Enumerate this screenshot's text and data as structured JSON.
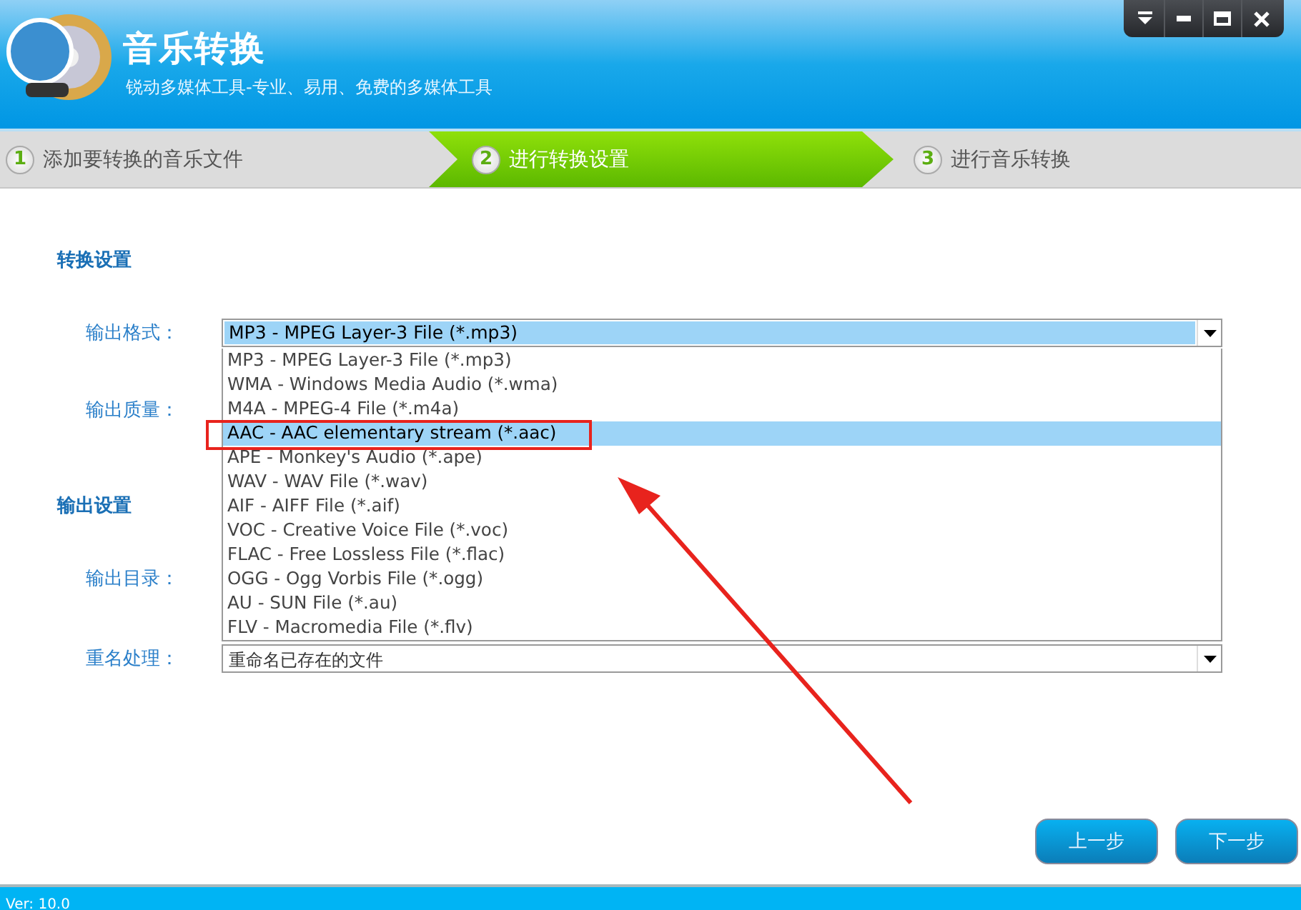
{
  "window": {
    "title": "音乐转换",
    "subtitle": "锐动多媒体工具-专业、易用、免费的多媒体工具"
  },
  "steps": [
    {
      "number": "1",
      "label": "添加要转换的音乐文件",
      "selected": false
    },
    {
      "number": "2",
      "label": "进行转换设置",
      "selected": true
    },
    {
      "number": "3",
      "label": "进行音乐转换",
      "selected": false
    }
  ],
  "conversion_settings": {
    "heading": "转换设置",
    "format": {
      "label": "输出格式：",
      "value": "MP3 - MPEG Layer-3 File (*.mp3)",
      "expanded": true,
      "options": [
        {
          "label": "MP3 - MPEG Layer-3 File (*.mp3)",
          "highlighted": false,
          "boxed": false
        },
        {
          "label": "WMA - Windows Media Audio (*.wma)",
          "highlighted": false,
          "boxed": false
        },
        {
          "label": "M4A - MPEG-4 File (*.m4a)",
          "highlighted": false,
          "boxed": false
        },
        {
          "label": "AAC - AAC elementary stream (*.aac)",
          "highlighted": true,
          "boxed": true
        },
        {
          "label": "APE - Monkey's Audio (*.ape)",
          "highlighted": false,
          "boxed": false
        },
        {
          "label": "WAV - WAV File (*.wav)",
          "highlighted": false,
          "boxed": false
        },
        {
          "label": "AIF - AIFF File (*.aif)",
          "highlighted": false,
          "boxed": false
        },
        {
          "label": "VOC - Creative Voice File (*.voc)",
          "highlighted": false,
          "boxed": false
        },
        {
          "label": "FLAC - Free Lossless File (*.flac)",
          "highlighted": false,
          "boxed": false
        },
        {
          "label": "OGG - Ogg Vorbis File (*.ogg)",
          "highlighted": false,
          "boxed": false
        },
        {
          "label": "AU - SUN File (*.au)",
          "highlighted": false,
          "boxed": false
        },
        {
          "label": "FLV - Macromedia File (*.flv)",
          "highlighted": false,
          "boxed": false
        }
      ]
    },
    "quality": {
      "label": "输出质量："
    }
  },
  "output_settings": {
    "heading": "输出设置",
    "directory": {
      "label": "输出目录："
    },
    "rename": {
      "label": "重名处理：",
      "value": "重命名已存在的文件"
    }
  },
  "buttons": [
    {
      "label": "上一步"
    },
    {
      "label": "下一步"
    }
  ],
  "annotation": {
    "kind": "arrow"
  },
  "status_bar": {
    "version": "Ver: 10.0"
  }
}
